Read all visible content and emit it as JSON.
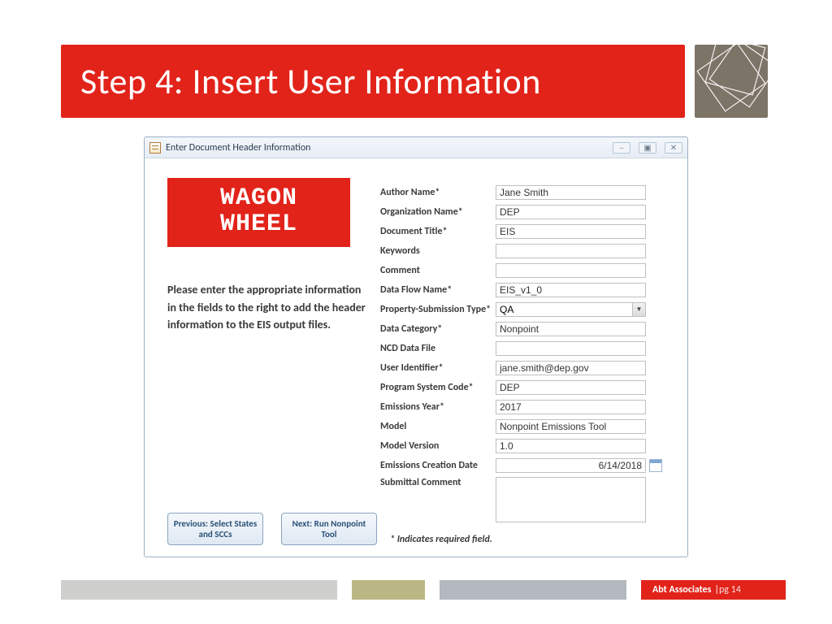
{
  "slide": {
    "title": "Step 4: Insert User Information"
  },
  "window": {
    "title": "Enter Document Header Information",
    "logo_line1": "WAGON",
    "logo_line2": "WHEEL",
    "instruction": "Please enter the appropriate information in the fields to the right to add the header information to the EIS output files.",
    "prev_button": "Previous: Select States and SCCs",
    "next_button": "Next: Run Nonpoint Tool",
    "required_note": "* Indicates required field."
  },
  "form": {
    "author_label": "Author Name*",
    "author_value": "Jane Smith",
    "org_label": "Organization Name*",
    "org_value": "DEP",
    "doctitle_label": "Document Title*",
    "doctitle_value": "EIS",
    "keywords_label": "Keywords",
    "keywords_value": "",
    "comment_label": "Comment",
    "comment_value": "",
    "dataflow_label": "Data Flow Name*",
    "dataflow_value": "EIS_v1_0",
    "subtype_label": "Property-Submission Type*",
    "subtype_value": "QA",
    "datacat_label": "Data Category*",
    "datacat_value": "Nonpoint",
    "ncd_label": "NCD Data File",
    "ncd_value": "",
    "userid_label": "User Identifier*",
    "userid_value": "jane.smith@dep.gov",
    "psc_label": "Program System Code*",
    "psc_value": "DEP",
    "year_label": "Emissions Year*",
    "year_value": "2017",
    "model_label": "Model",
    "model_value": "Nonpoint Emissions Tool",
    "modelv_label": "Model Version",
    "modelv_value": "1.0",
    "ecd_label": "Emissions Creation Date",
    "ecd_value": "6/14/2018",
    "submittal_label": "Submittal Comment",
    "submittal_value": ""
  },
  "footer": {
    "org": "Abt Associates",
    "sep": " | ",
    "page": "pg 14"
  }
}
